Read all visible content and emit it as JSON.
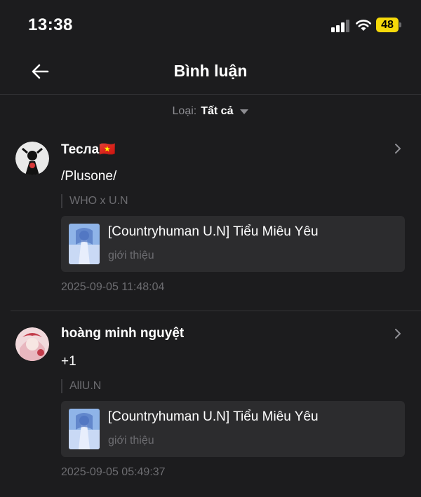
{
  "status_bar": {
    "time": "13:38",
    "battery": "48"
  },
  "header": {
    "title": "Bình luận"
  },
  "filter": {
    "label": "Loại:",
    "value": "Tất cả"
  },
  "comments": [
    {
      "username": "Тесла🇻🇳",
      "text": "/Plusone/",
      "quote": "WHO x U.N",
      "book_title": "[Countryhuman U.N] Tiểu Miêu Yêu",
      "book_subtitle": "giới thiệu",
      "timestamp": "2025-09-05 11:48:04"
    },
    {
      "username": "hoàng minh nguyệt",
      "text": "+1",
      "quote": "AllU.N",
      "book_title": "[Countryhuman U.N] Tiểu Miêu Yêu",
      "book_subtitle": "giới thiệu",
      "timestamp": "2025-09-05 05:49:37"
    }
  ],
  "colors": {
    "background": "#1c1c1e",
    "card": "#2c2c2e",
    "muted": "#6c6c70",
    "battery": "#f5d90a"
  },
  "icons": {
    "back": "arrow-left-icon",
    "chevron": "chevron-right-icon",
    "filter": "caret-down-icon"
  }
}
